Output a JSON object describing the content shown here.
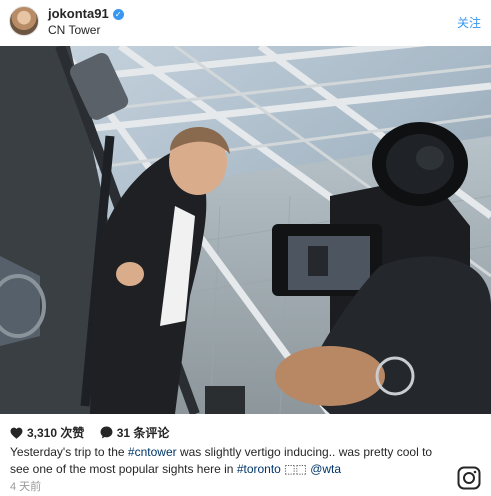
{
  "post": {
    "username": "jokonta91",
    "location": "CN Tower",
    "follow_label": "关注",
    "likes": "3,310 次赞",
    "comments": "31 条评论",
    "caption": {
      "part1": "Yesterday's trip to the ",
      "tag1": "#cntower",
      "part2": " was slightly vertigo inducing.. was pretty cool to see one of the most popular sights here in ",
      "tag2": "#toronto",
      "emoji": " ⬚⬚ ",
      "mention": "@wta"
    },
    "time": "4 天前"
  },
  "icons": [
    "verified-badge-icon",
    "heart-icon",
    "comment-icon",
    "instagram-logo-icon"
  ],
  "colors": {
    "link": "#3897f0",
    "hashtag": "#003569",
    "text": "#262626",
    "muted": "#999999"
  }
}
